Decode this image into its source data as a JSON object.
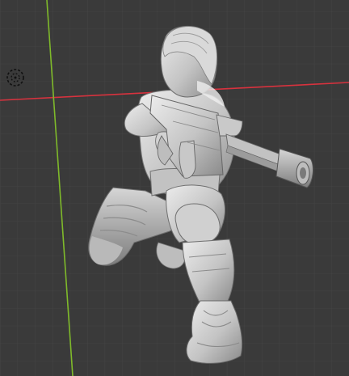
{
  "viewport": {
    "background": "#3a3a3a",
    "grid": {
      "minor_color": "#434343",
      "major_color": "#2f2f2f"
    },
    "axes": {
      "x_color": "#d8323e",
      "y_color": "#7fba2a"
    },
    "model": {
      "material_color": "#cfcfcf",
      "shadow_color": "#8a8a8a",
      "highlight_color": "#ececec"
    },
    "origin_marker_icon": "light-origin-icon"
  }
}
